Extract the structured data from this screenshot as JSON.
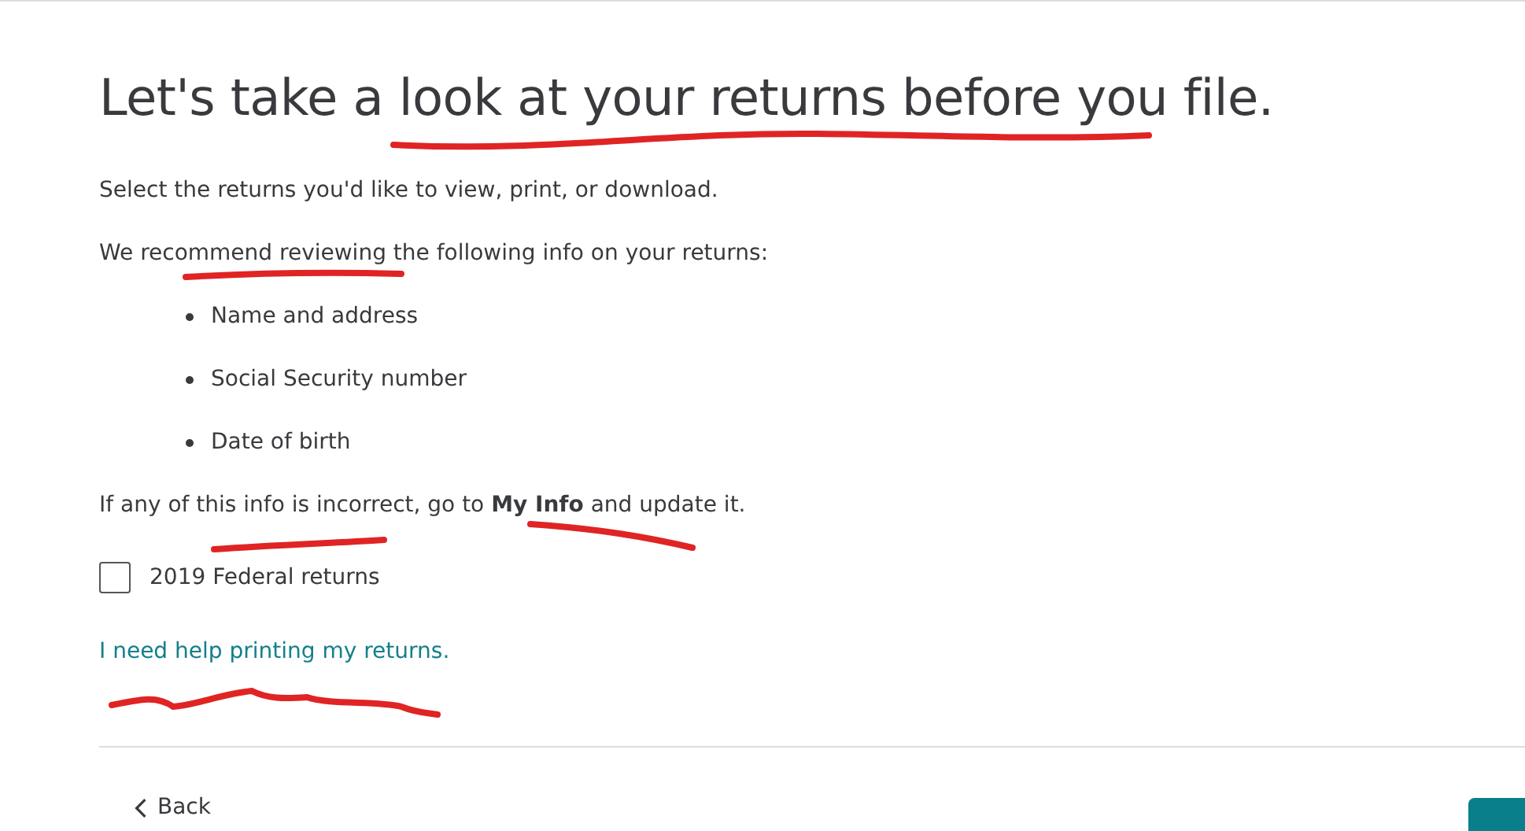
{
  "heading": "Let's take a look at your returns before you file.",
  "intro": "Select the returns you'd like to view, print, or download.",
  "recommend": "We recommend reviewing the following info on your returns:",
  "bullets": [
    "Name and address",
    "Social Security number",
    "Date of birth"
  ],
  "incorrect_note": "If any of this info is incorrect, go to **My Info** and update it.",
  "returns": [
    {
      "label": "2019 Federal returns",
      "checked": false
    }
  ],
  "help_link": "I need help printing my returns.",
  "back_button": {
    "label": "Back"
  }
}
